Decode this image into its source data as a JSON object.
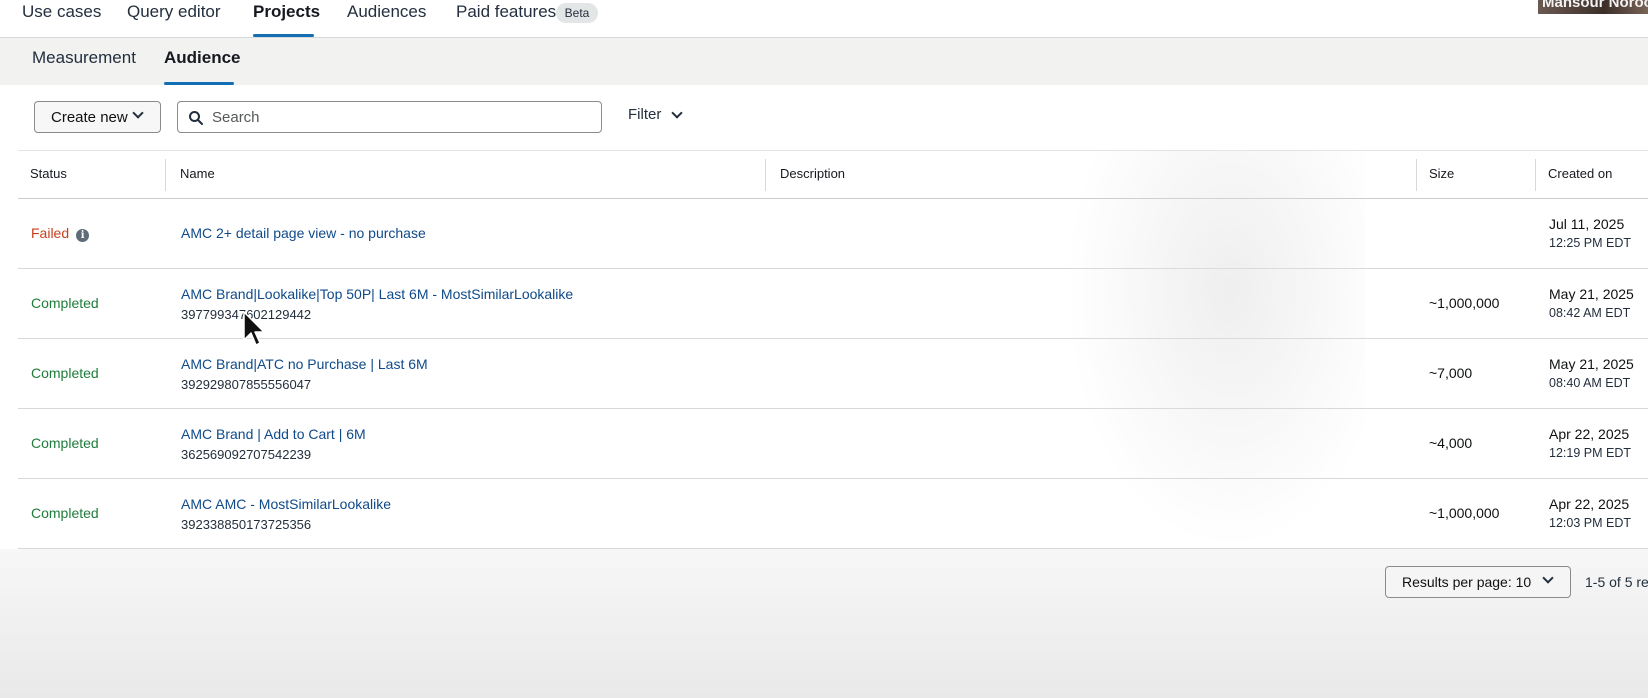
{
  "nav": {
    "tabs": [
      {
        "label": "Use cases"
      },
      {
        "label": "Query editor"
      },
      {
        "label": "Projects",
        "active": true
      },
      {
        "label": "Audiences"
      },
      {
        "label": "Paid features"
      }
    ],
    "beta_badge": "Beta",
    "user_name": "Mansour Noroo"
  },
  "subnav": {
    "tabs": [
      {
        "label": "Measurement"
      },
      {
        "label": "Audience",
        "active": true
      }
    ]
  },
  "toolbar": {
    "create_label": "Create new",
    "search_placeholder": "Search",
    "search_value": "",
    "filter_label": "Filter"
  },
  "table": {
    "columns": [
      "Status",
      "Name",
      "Description",
      "Size",
      "Created on"
    ],
    "rows": [
      {
        "status": "Failed",
        "name": "AMC 2+ detail page view - no purchase",
        "id": "",
        "description": "",
        "size": "",
        "date": "Jul 11, 2025",
        "time": "12:25 PM EDT"
      },
      {
        "status": "Completed",
        "name": "AMC Brand|Lookalike|Top 50P| Last 6M - MostSimilarLookalike",
        "id": "397799347602129442",
        "description": "",
        "size": "~1,000,000",
        "date": "May 21, 2025",
        "time": "08:42 AM EDT"
      },
      {
        "status": "Completed",
        "name": "AMC Brand|ATC no Purchase | Last 6M",
        "id": "392929807855556047",
        "description": "",
        "size": "~7,000",
        "date": "May 21, 2025",
        "time": "08:40 AM EDT"
      },
      {
        "status": "Completed",
        "name": "AMC Brand | Add to Cart | 6M",
        "id": "362569092707542239",
        "description": "",
        "size": "~4,000",
        "date": "Apr 22, 2025",
        "time": "12:19 PM EDT"
      },
      {
        "status": "Completed",
        "name": "AMC AMC - MostSimilarLookalike",
        "id": "392338850173725356",
        "description": "",
        "size": "~1,000,000",
        "date": "Apr 22, 2025",
        "time": "12:03 PM EDT"
      }
    ]
  },
  "pagination": {
    "results_per_page_label": "Results per page: 10",
    "count_text": "1-5 of 5 re"
  },
  "colors": {
    "accent": "#146eb4",
    "link": "#0f4a8a",
    "failed": "#c7411e",
    "completed": "#1e7d3a"
  }
}
